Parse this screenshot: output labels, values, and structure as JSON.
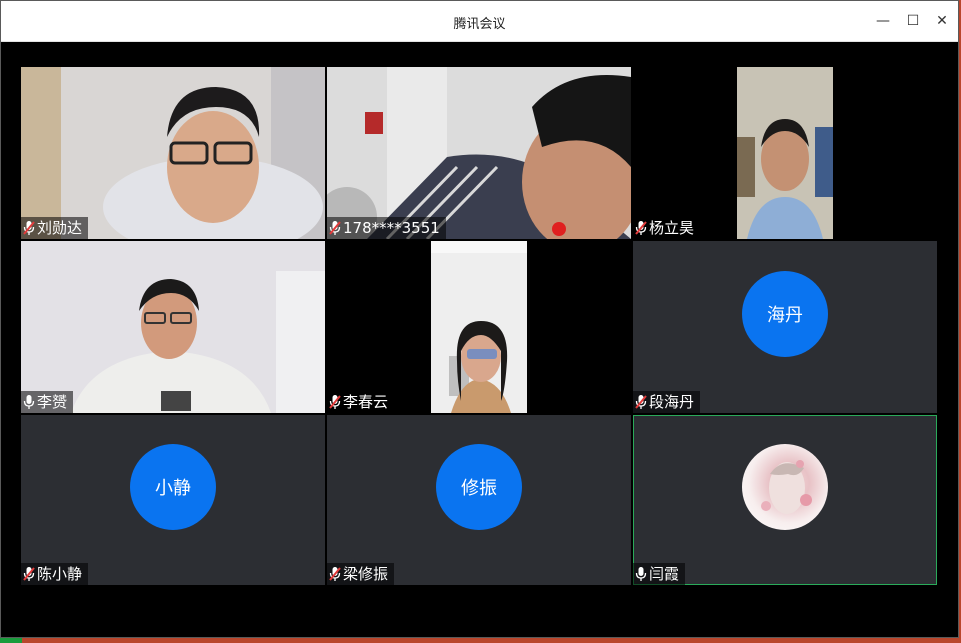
{
  "window": {
    "title": "腾讯会议",
    "minimize_label": "—",
    "maximize_label": "☐",
    "close_label": "✕"
  },
  "participants": [
    {
      "name": "刘勋达",
      "mic": "muted",
      "type": "video"
    },
    {
      "name": "178****3551",
      "mic": "muted",
      "type": "video"
    },
    {
      "name": "杨立昊",
      "mic": "muted",
      "type": "video"
    },
    {
      "name": "李赟",
      "mic": "on",
      "type": "video"
    },
    {
      "name": "李春云",
      "mic": "muted",
      "type": "video"
    },
    {
      "name": "段海丹",
      "mic": "muted",
      "type": "avatar",
      "avatar_text": "海丹"
    },
    {
      "name": "陈小静",
      "mic": "muted",
      "type": "avatar",
      "avatar_text": "小静"
    },
    {
      "name": "梁修振",
      "mic": "muted",
      "type": "avatar",
      "avatar_text": "修振"
    },
    {
      "name": "闫霞",
      "mic": "on",
      "type": "avatar-image",
      "active_speaker": true
    }
  ],
  "colors": {
    "avatar_blue": "#0a74f0",
    "tile_bg": "#2c2e33",
    "active_border": "#2aaa5a",
    "muted_slash": "#e23b3b"
  }
}
